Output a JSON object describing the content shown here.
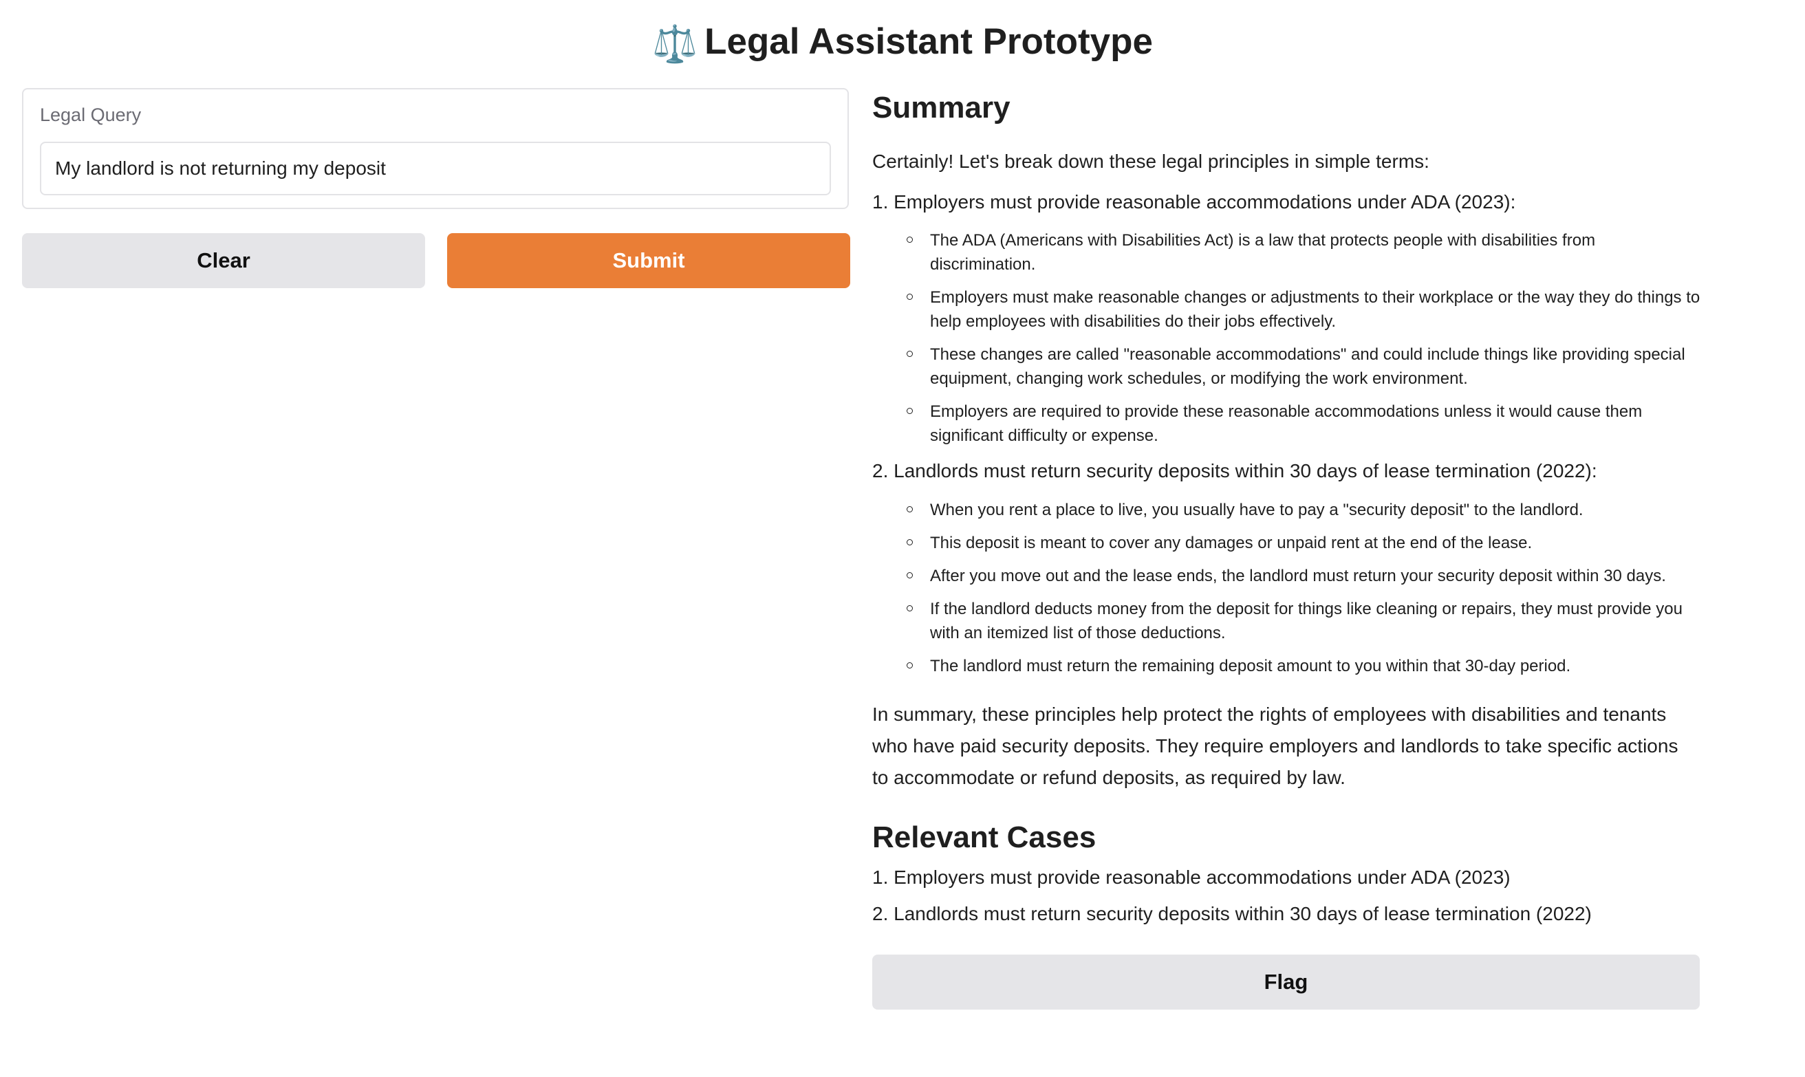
{
  "header": {
    "icon": "scales-icon",
    "icon_glyph": "⚖️",
    "title": "Legal Assistant Prototype"
  },
  "query": {
    "label": "Legal Query",
    "value": "My landlord is not returning my deposit"
  },
  "buttons": {
    "clear": "Clear",
    "submit": "Submit",
    "flag": "Flag"
  },
  "colors": {
    "accent": "#ea7e36",
    "secondary_button": "#e5e5e8"
  },
  "summary": {
    "heading": "Summary",
    "intro": "Certainly! Let's break down these legal principles in simple terms:",
    "points": [
      {
        "title": "1. Employers must provide reasonable accommodations under ADA (2023):",
        "bullets": [
          "The ADA (Americans with Disabilities Act) is a law that protects people with disabilities from discrimination.",
          "Employers must make reasonable changes or adjustments to their workplace or the way they do things to help employees with disabilities do their jobs effectively.",
          "These changes are called \"reasonable accommodations\" and could include things like providing special equipment, changing work schedules, or modifying the work environment.",
          "Employers are required to provide these reasonable accommodations unless it would cause them significant difficulty or expense."
        ]
      },
      {
        "title": "2. Landlords must return security deposits within 30 days of lease termination (2022):",
        "bullets": [
          "When you rent a place to live, you usually have to pay a \"security deposit\" to the landlord.",
          "This deposit is meant to cover any damages or unpaid rent at the end of the lease.",
          "After you move out and the lease ends, the landlord must return your security deposit within 30 days.",
          "If the landlord deducts money from the deposit for things like cleaning or repairs, they must provide you with an itemized list of those deductions.",
          "The landlord must return the remaining deposit amount to you within that 30-day period."
        ]
      }
    ],
    "conclusion": "In summary, these principles help protect the rights of employees with disabilities and tenants who have paid security deposits. They require employers and landlords to take specific actions to accommodate or refund deposits, as required by law."
  },
  "cases": {
    "heading": "Relevant Cases",
    "items": [
      "1. Employers must provide reasonable accommodations under ADA (2023)",
      "2. Landlords must return security deposits within 30 days of lease termination (2022)"
    ]
  }
}
